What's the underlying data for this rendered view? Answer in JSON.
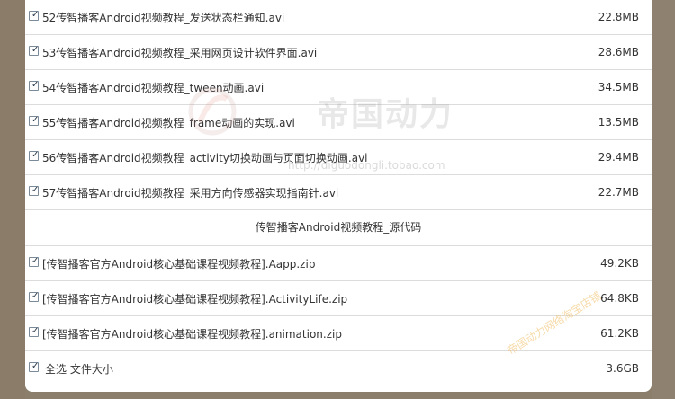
{
  "files": [
    {
      "name": "52传智播客Android视频教程_发送状态栏通知.avi",
      "size": "22.8MB"
    },
    {
      "name": "53传智播客Android视频教程_采用网页设计软件界面.avi",
      "size": "28.6MB"
    },
    {
      "name": "54传智播客Android视频教程_tween动画.avi",
      "size": "34.5MB"
    },
    {
      "name": "55传智播客Android视频教程_frame动画的实现.avi",
      "size": "13.5MB"
    },
    {
      "name": "56传智播客Android视频教程_activity切换动画与页面切换动画.avi",
      "size": "29.4MB"
    },
    {
      "name": "57传智播客Android视频教程_采用方向传感器实现指南针.avi",
      "size": "22.7MB"
    }
  ],
  "section_title": "传智播客Android视频教程_源代码",
  "source_files": [
    {
      "name": "[传智播客官方Android核心基础课程视频教程].Aapp.zip",
      "size": "49.2KB"
    },
    {
      "name": "[传智播客官方Android核心基础课程视频教程].ActivityLife.zip",
      "size": "64.8KB"
    },
    {
      "name": "[传智播客官方Android核心基础课程视频教程].animation.zip",
      "size": "61.2KB"
    }
  ],
  "summary": {
    "label": "全选 文件大小",
    "size": "3.6GB"
  },
  "checkbox_glyph": "✓",
  "watermark": {
    "brand": "帝国动力",
    "url": "http://diguodongli.tobao.com",
    "corner": "帝国动力网络淘宝店铺"
  },
  "colors": {
    "background": "#8b7e6a",
    "panel": "#ffffff",
    "divider": "#dcdcdc",
    "text": "#333333"
  }
}
